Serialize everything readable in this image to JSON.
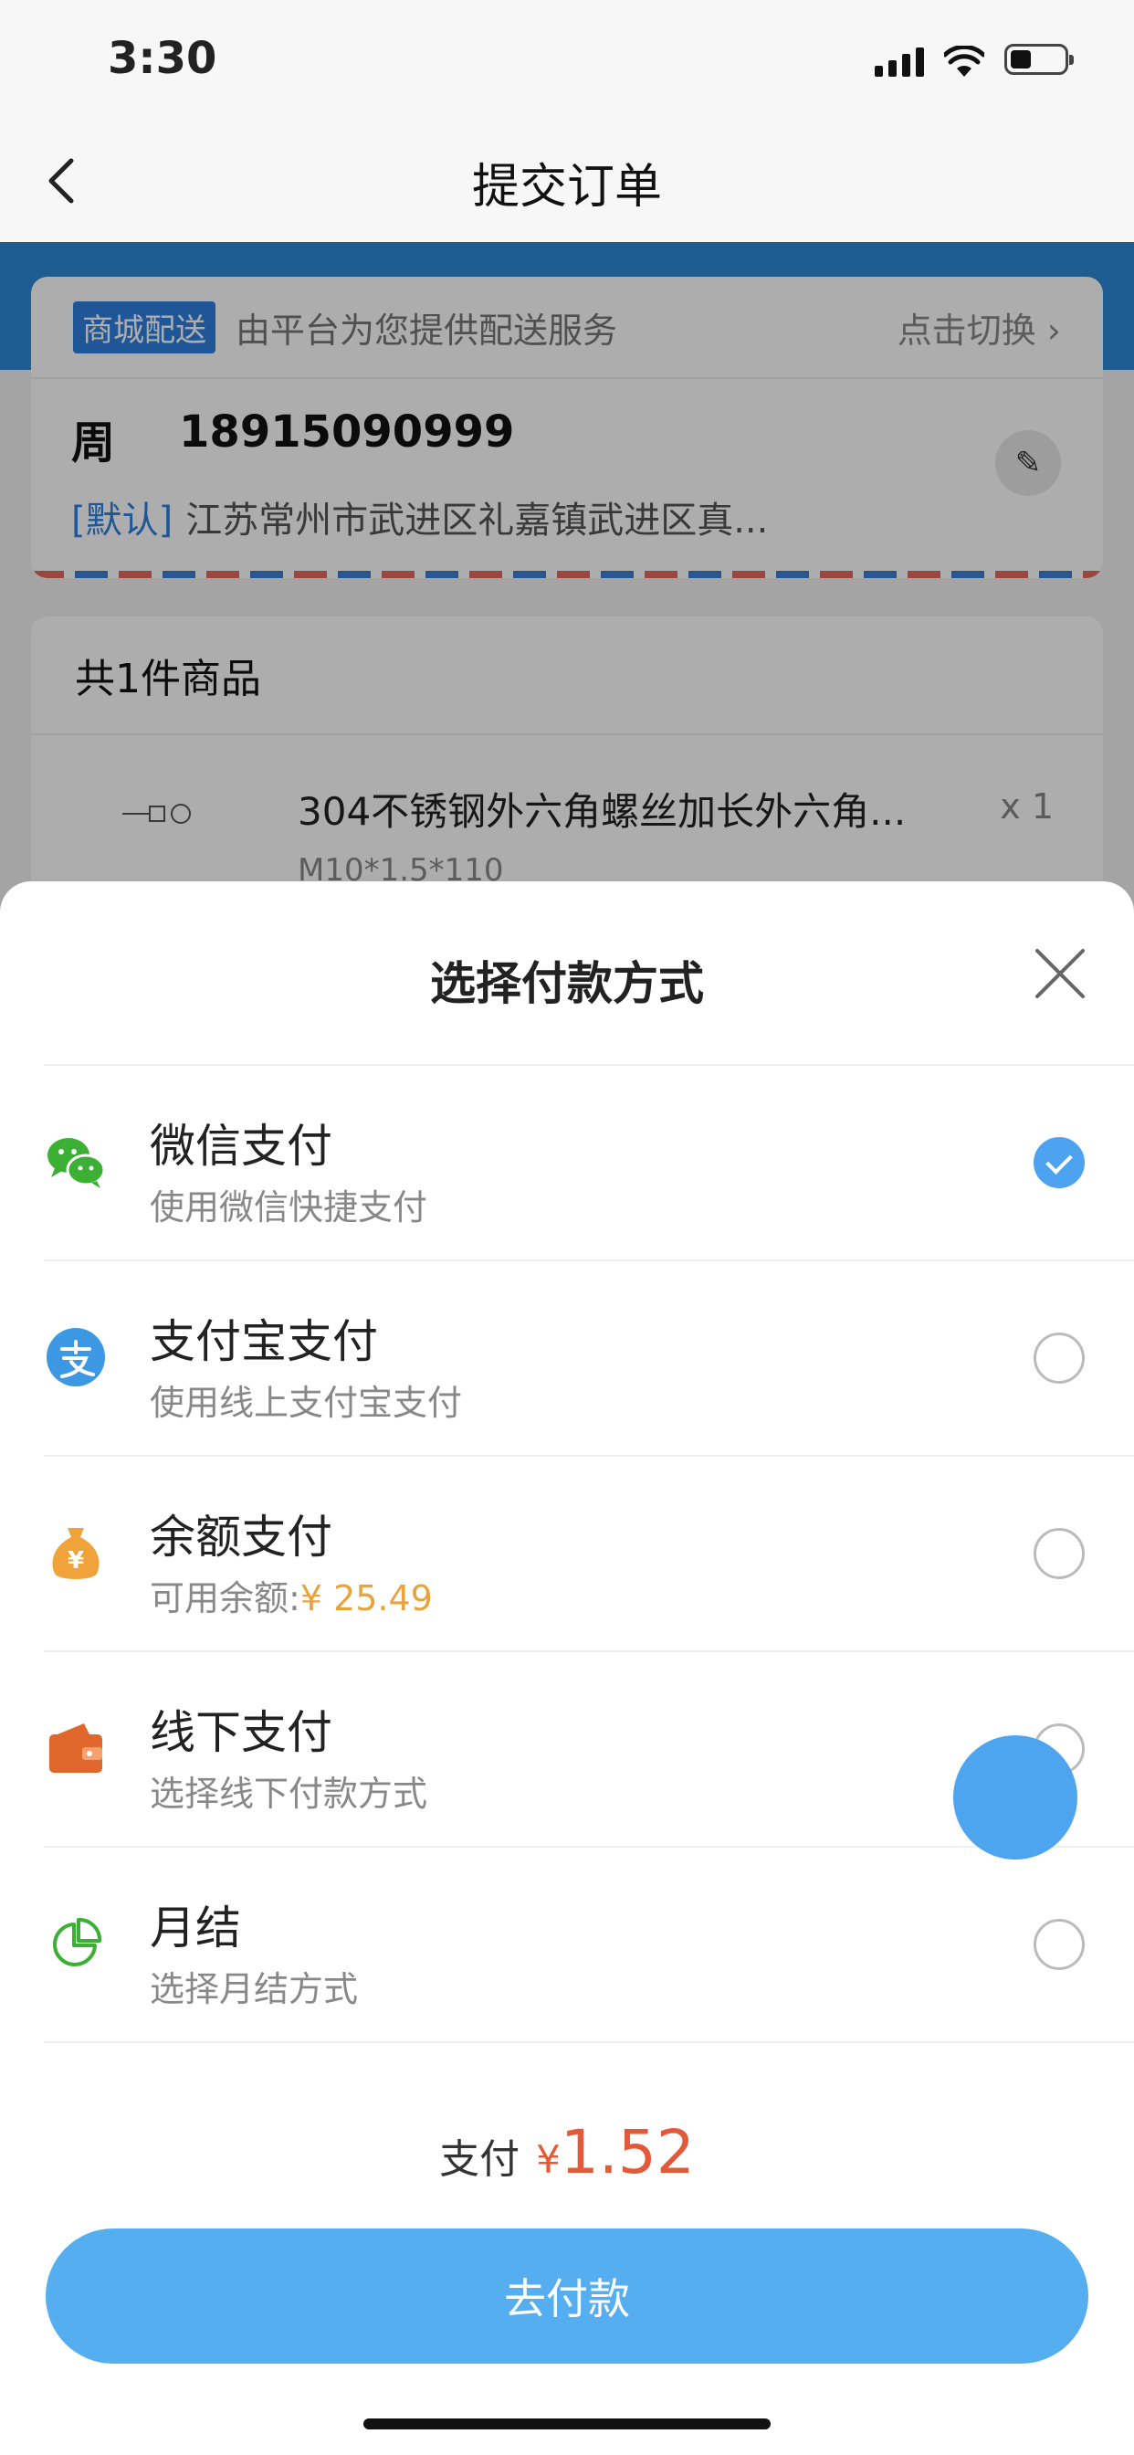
{
  "status_bar": {
    "time": "3:30"
  },
  "nav": {
    "title": "提交订单"
  },
  "address_card": {
    "delivery_tag": "商城配送",
    "delivery_desc": "由平台为您提供配送服务",
    "switch_label": "点击切换",
    "recipient_name": "周",
    "phone": "18915090999",
    "default_tag": "[默认]",
    "address": "江苏常州市武进区礼嘉镇武进区真..."
  },
  "goods": {
    "count_label": "共1件商品",
    "item_name": "304不锈钢外六角螺丝加长外六角...",
    "item_spec": "M10*1.5*110",
    "item_qty": "x 1"
  },
  "payment_sheet": {
    "title": "选择付款方式",
    "methods": [
      {
        "label": "微信支付",
        "desc": "使用微信快捷支付",
        "icon": "wechat-icon",
        "selected": true
      },
      {
        "label": "支付宝支付",
        "desc": "使用线上支付宝支付",
        "icon": "alipay-icon",
        "selected": false
      },
      {
        "label": "余额支付",
        "desc_prefix": "可用余额:",
        "desc_amount": "¥ 25.49",
        "icon": "money-bag-icon",
        "selected": false
      },
      {
        "label": "线下支付",
        "desc": "选择线下付款方式",
        "icon": "wallet-icon",
        "selected": false
      },
      {
        "label": "月结",
        "desc": "选择月结方式",
        "icon": "pie-chart-icon",
        "selected": false
      }
    ],
    "total_label": "支付",
    "currency": "¥",
    "total_amount": "1.52",
    "pay_button": "去付款"
  },
  "colors": {
    "accent_blue": "#4da3ef",
    "price_red": "#e25a3a",
    "balance_orange": "#e8a33d",
    "wechat_green": "#3cb034",
    "alipay_blue": "#3d98e3"
  }
}
